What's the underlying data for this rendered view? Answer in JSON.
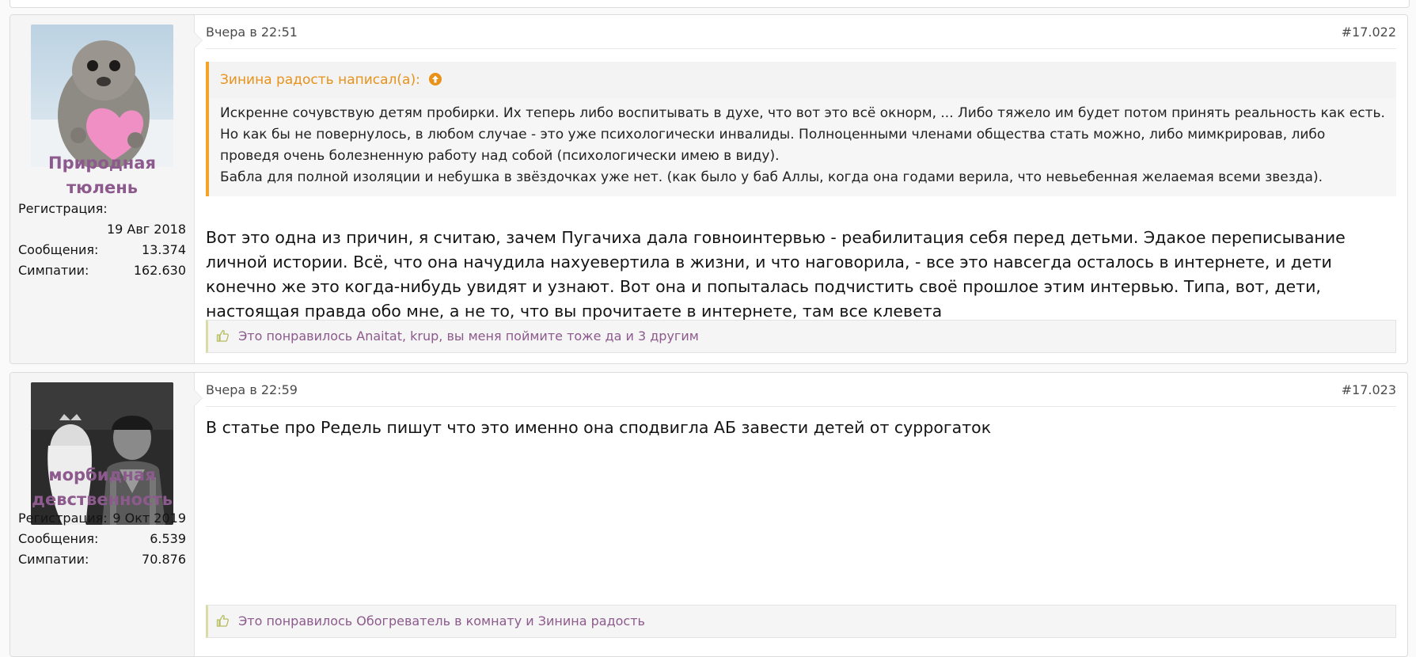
{
  "posts": [
    {
      "username_line1": "Природная",
      "username_line2": "тюлень",
      "stats": {
        "reg_label": "Регистрация:",
        "reg_value": "19 Авг 2018",
        "msgs_label": "Сообщения:",
        "msgs_value": "13.374",
        "likes_label": "Симпатии:",
        "likes_value": "162.630"
      },
      "date": "Вчера в 22:51",
      "number": "#17.022",
      "quote": {
        "author": "Зинина радость написал(а):",
        "lines": [
          "Искренне сочувствую детям пробирки. Их теперь либо воспитывать в духе, что вот это всё окнорм, ... Либо тяжело им будет потом принять реальность как есть. Но как бы не повернулось, в любом случае - это уже психологически инвалиды. Полноценными членами общества стать можно, либо мимкрировав, либо проведя очень болезненную работу над собой (психологически имею в виду).",
          "Бабла для полной изоляции и небушка в звёздочках уже нет. (как было у баб Аллы, когда она годами верила, что невьебенная желаемая всеми звезда)."
        ]
      },
      "message": "Вот это одна из причин, я считаю, зачем Пугачиха дала говноинтервью - реабилитация себя перед детьми. Эдакое переписывание личной истории. Всё, что она начудила нахуевертила в жизни, и что наговорила, - все это навсегда осталось в интернете, и дети конечно же это когда-нибудь увидят и узнают. Вот она и попыталась подчистить своё прошлое этим интервью. Типа, вот, дети, настоящая правда обо мне, а не то, что вы прочитаете в интернете, там все клевета",
      "likes_text": "Это понравилось Anaitat, krup, вы меня поймите тоже да и 3 другим"
    },
    {
      "username_line1": "морбидная",
      "username_line2": "девственность",
      "stats": {
        "reg_label": "Регистрация:",
        "reg_value": "9 Окт 2019",
        "msgs_label": "Сообщения:",
        "msgs_value": "6.539",
        "likes_label": "Симпатии:",
        "likes_value": "70.876"
      },
      "date": "Вчера в 22:59",
      "number": "#17.023",
      "message": "В статье про Редель пишут что это именно она сподвигла АБ завести детей от суррогаток",
      "likes_text": "Это понравилось Обогреватель в комнату и Зинина радость"
    }
  ],
  "icons": {
    "quote_jump": "arrow-up-circle-icon",
    "like": "thumbs-up-icon"
  },
  "colors": {
    "username": "#8c5a8c",
    "quote_accent": "#f3a326",
    "likes_accent": "#d9dca6"
  }
}
